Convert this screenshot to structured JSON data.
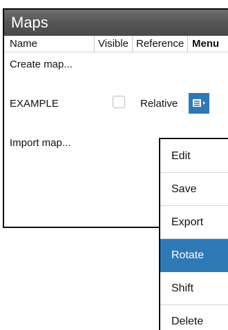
{
  "dialog": {
    "title": "Maps",
    "columns": {
      "name": "Name",
      "visible": "Visible",
      "reference": "Reference",
      "menu": "Menu"
    },
    "rows": [
      {
        "name": "Create map..."
      },
      {
        "name": "EXAMPLE",
        "visible": false,
        "reference": "Relative",
        "menu_icon": "menu-list-icon"
      },
      {
        "name": "Import map..."
      }
    ]
  },
  "popup_menu": {
    "items": [
      {
        "label": "Edit"
      },
      {
        "label": "Save"
      },
      {
        "label": "Export"
      },
      {
        "label": "Rotate",
        "selected": true
      },
      {
        "label": "Shift"
      },
      {
        "label": "Delete"
      }
    ]
  },
  "colors": {
    "accent": "#2f78b6",
    "title_bar": "#555555",
    "border": "#0c0c0c"
  }
}
